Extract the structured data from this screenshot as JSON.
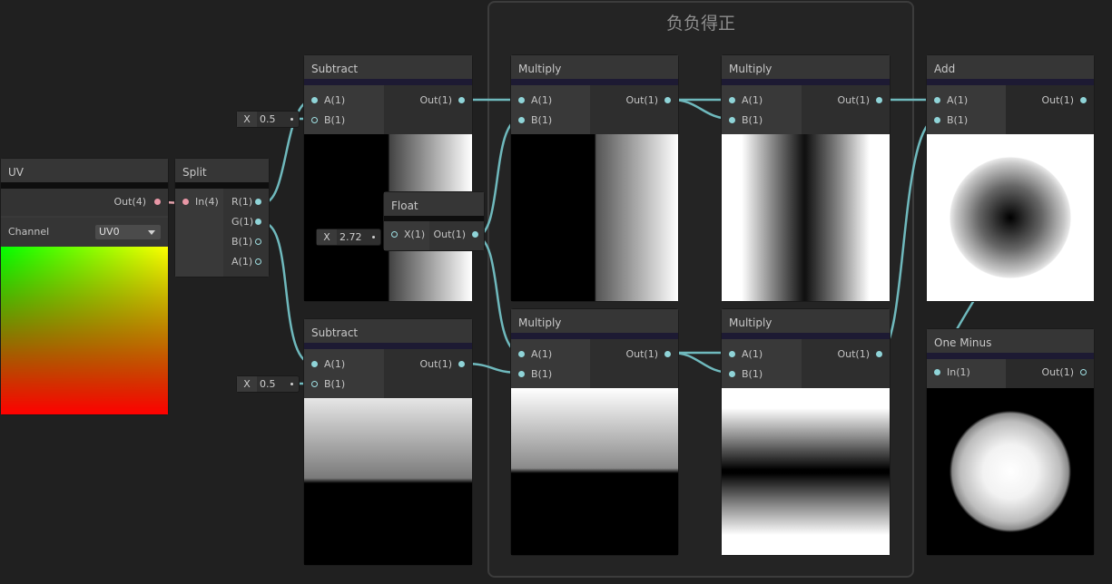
{
  "group": {
    "title": "负负得正"
  },
  "nodes": {
    "uv": {
      "title": "UV",
      "out": "Out(4)",
      "channel_label": "Channel",
      "channel_value": "UV0"
    },
    "split": {
      "title": "Split",
      "in": "In(4)",
      "outs": [
        "R(1)",
        "G(1)",
        "B(1)",
        "A(1)"
      ]
    },
    "subtract1": {
      "title": "Subtract",
      "in_a": "A(1)",
      "in_b": "B(1)",
      "out": "Out(1)"
    },
    "subtract2": {
      "title": "Subtract",
      "in_a": "A(1)",
      "in_b": "B(1)",
      "out": "Out(1)"
    },
    "float": {
      "title": "Float",
      "in": "X(1)",
      "out": "Out(1)"
    },
    "multiply1": {
      "title": "Multiply",
      "in_a": "A(1)",
      "in_b": "B(1)",
      "out": "Out(1)"
    },
    "multiply2": {
      "title": "Multiply",
      "in_a": "A(1)",
      "in_b": "B(1)",
      "out": "Out(1)"
    },
    "multiply3": {
      "title": "Multiply",
      "in_a": "A(1)",
      "in_b": "B(1)",
      "out": "Out(1)"
    },
    "multiply4": {
      "title": "Multiply",
      "in_a": "A(1)",
      "in_b": "B(1)",
      "out": "Out(1)"
    },
    "add": {
      "title": "Add",
      "in_a": "A(1)",
      "in_b": "B(1)",
      "out": "Out(1)"
    },
    "one_minus": {
      "title": "One Minus",
      "in": "In(1)",
      "out": "Out(1)"
    }
  },
  "inputs": {
    "sub1_b": {
      "label": "X",
      "value": "0.5"
    },
    "sub2_b": {
      "label": "X",
      "value": "0.5"
    },
    "float_x": {
      "label": "X",
      "value": "2.72"
    }
  },
  "colors": {
    "wire": "#6fb9bd",
    "accent_bar": "#1d1a33",
    "background": "#202020"
  }
}
